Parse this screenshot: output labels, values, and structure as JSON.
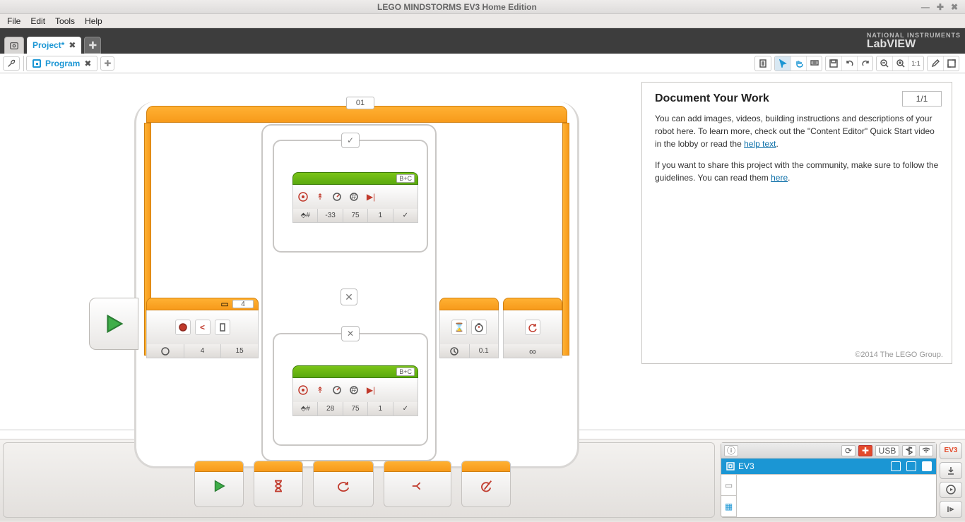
{
  "window": {
    "title": "LEGO MINDSTORMS EV3 Home Edition"
  },
  "menu": {
    "file": "File",
    "edit": "Edit",
    "tools": "Tools",
    "help": "Help"
  },
  "brand": {
    "vendor": "NATIONAL INSTRUMENTS",
    "product": "LabVIEW"
  },
  "project_tab": {
    "name": "Project*"
  },
  "program_tab": {
    "name": "Program"
  },
  "doc": {
    "heading": "Document Your Work",
    "pager": "1/1",
    "p1a": "You can add images, videos, building instructions and descriptions of your robot here. To learn more, check out the \"Content Editor\" Quick Start video in the lobby or read the ",
    "p1_link": "help text",
    "p1b": ".",
    "p2a": "If you want to share this project with the community, make sure to follow the guidelines. You can read them ",
    "p2_link": "here",
    "p2b": ".",
    "copyright": "©2014 The LEGO Group."
  },
  "loop": {
    "name": "01"
  },
  "switch_block": {
    "sensor_port": "4",
    "compare_threshold": "15",
    "mode_index": "4",
    "case_true_icon": "✓",
    "case_false_icon": "✕"
  },
  "move_true": {
    "ports": "B+C",
    "steering": "-33",
    "power": "75",
    "rotations": "1"
  },
  "move_false": {
    "ports": "B+C",
    "steering": "28",
    "power": "75",
    "rotations": "1"
  },
  "wait_block": {
    "seconds": "0.1"
  },
  "loop_end": {
    "mode": "∞"
  },
  "brick": {
    "usb_label": "USB",
    "device_name": "EV3",
    "side_label": "EV3"
  }
}
